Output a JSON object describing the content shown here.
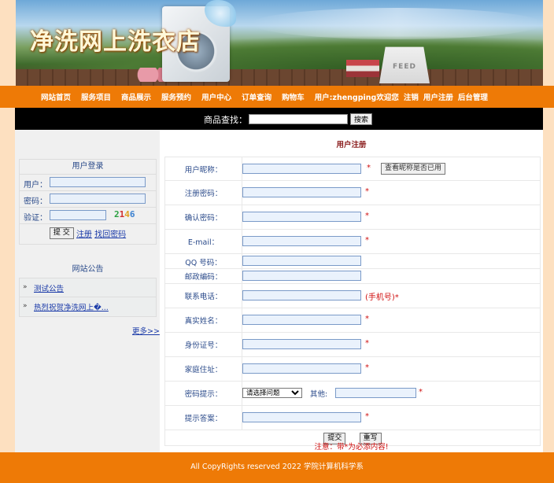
{
  "banner": {
    "title": "净洗网上洗衣店",
    "bag_text": "FEED"
  },
  "nav": {
    "items": [
      "网站首页",
      "服务项目",
      "商品展示",
      "服务预约",
      "用户中心",
      "订单查询",
      "购物车",
      "用户:zhengping欢迎您",
      "注销",
      "用户注册",
      "后台管理"
    ]
  },
  "search": {
    "label": "商品查找：",
    "value": "",
    "button": "搜索"
  },
  "login": {
    "title": "用户登录",
    "user_label": "用户：",
    "pass_label": "密码：",
    "captcha_label": "验证：",
    "captcha_digits": [
      "2",
      "1",
      "4",
      "6"
    ],
    "submit": "提 交",
    "register": "注册",
    "recover": "找回密码"
  },
  "notice": {
    "title": "网站公告",
    "items": [
      {
        "arrow": "»",
        "text": "测试公告"
      },
      {
        "arrow": "»",
        "text": "热烈祝贺净洗网上�..."
      }
    ],
    "more": "更多>>"
  },
  "register": {
    "title": "用户注册",
    "required_mark": "*",
    "fields": [
      {
        "label": "用户昵称：",
        "value": "",
        "required": true,
        "button": "查看昵称是否已用"
      },
      {
        "label": "注册密码：",
        "value": "",
        "required": true
      },
      {
        "label": "确认密码：",
        "value": "",
        "required": true
      },
      {
        "label": "E-mail：",
        "value": "",
        "required": true
      },
      {
        "label": "QQ 号码：",
        "value": "",
        "required": false
      },
      {
        "label": "邮政编码：",
        "value": "",
        "required": false
      },
      {
        "label": "联系电话：",
        "value": "",
        "required": false,
        "hint": "(手机号)*"
      },
      {
        "label": "真实姓名：",
        "value": "",
        "required": true
      },
      {
        "label": "身份证号：",
        "value": "",
        "required": true
      },
      {
        "label": "家庭住址：",
        "value": "",
        "required": true
      }
    ],
    "question": {
      "label": "密码提示：",
      "selected": "请选择问题",
      "other_label": "其他:",
      "other_value": "",
      "required": true
    },
    "answer": {
      "label": "提示答案：",
      "value": "",
      "required": true
    },
    "submit": "提交",
    "reset": "重写",
    "note": "注意：带*为必添内容!"
  },
  "footer": {
    "text": "All CopyRights reserved 2022 学院计算机科学系"
  }
}
